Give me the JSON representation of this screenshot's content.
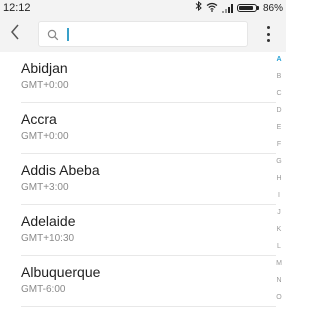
{
  "status_bar": {
    "time": "12:12",
    "battery_text": "86%",
    "battery_level": 0.86,
    "icons": [
      "bluetooth-icon",
      "wifi-icon",
      "signal-icon",
      "battery-icon"
    ]
  },
  "toolbar": {
    "back_icon": "chevron-left-icon",
    "search": {
      "placeholder": "",
      "value": ""
    },
    "menu_icon": "more-vertical-icon"
  },
  "timezones": [
    {
      "name": "Abidjan",
      "offset": "GMT+0:00"
    },
    {
      "name": "Accra",
      "offset": "GMT+0:00"
    },
    {
      "name": "Addis Abeba",
      "offset": "GMT+3:00"
    },
    {
      "name": "Adelaide",
      "offset": "GMT+10:30"
    },
    {
      "name": "Albuquerque",
      "offset": "GMT-6:00"
    }
  ],
  "index": {
    "letters": [
      "A",
      "B",
      "C",
      "D",
      "E",
      "F",
      "G",
      "H",
      "I",
      "J",
      "K",
      "L",
      "M",
      "N",
      "O"
    ],
    "active": "A"
  },
  "colors": {
    "accent": "#2aa3d6",
    "toolbar_bg": "#f3f3f3"
  }
}
